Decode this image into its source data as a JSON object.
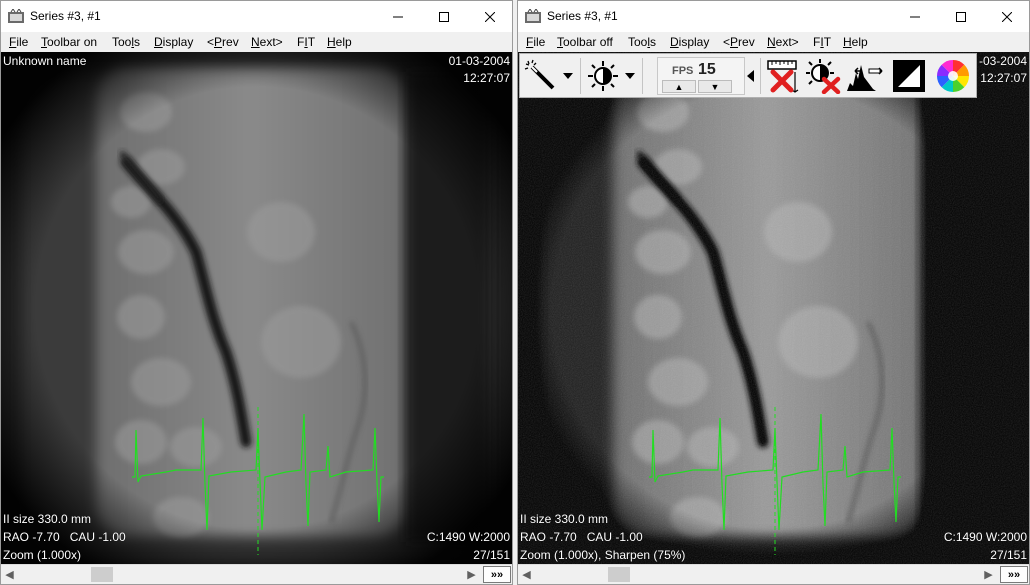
{
  "left_window": {
    "title": "Series #3, #1",
    "menu": {
      "file": {
        "pre": "",
        "acc": "F",
        "post": "ile"
      },
      "toolbar": {
        "pre": "",
        "acc": "T",
        "post": "oolbar on"
      },
      "tools": {
        "pre": "Too",
        "acc": "l",
        "post": "s"
      },
      "display": {
        "pre": "",
        "acc": "D",
        "post": "isplay"
      },
      "prev": {
        "pre": "<",
        "acc": "P",
        "post": "rev"
      },
      "next": {
        "pre": "",
        "acc": "N",
        "post": "ext>"
      },
      "fit": {
        "pre": "F",
        "acc": "I",
        "post": "T"
      },
      "help": {
        "pre": "",
        "acc": "H",
        "post": "elp"
      }
    },
    "overlay": {
      "patient_name": "Unknown name",
      "date": "01-03-2004",
      "time": "12:27:07",
      "ii_size": "II size 330.0 mm",
      "angles": "RAO -7.70   CAU -1.00",
      "zoom": "Zoom (1.000x)",
      "window": "C:1490 W:2000",
      "frame": "27/151"
    },
    "ff_label": "»»"
  },
  "right_window": {
    "title": "Series #3, #1",
    "menu": {
      "file": {
        "pre": "",
        "acc": "F",
        "post": "ile"
      },
      "toolbar": {
        "pre": "",
        "acc": "T",
        "post": "oolbar off"
      },
      "tools": {
        "pre": "Too",
        "acc": "l",
        "post": "s"
      },
      "display": {
        "pre": "",
        "acc": "D",
        "post": "isplay"
      },
      "prev": {
        "pre": "<",
        "acc": "P",
        "post": "rev"
      },
      "next": {
        "pre": "",
        "acc": "N",
        "post": "ext>"
      },
      "fit": {
        "pre": "F",
        "acc": "I",
        "post": "T"
      },
      "help": {
        "pre": "",
        "acc": "H",
        "post": "elp"
      }
    },
    "toolbar": {
      "fps_label": "FPS",
      "fps_value": "15",
      "icons": [
        "magic-wand-icon",
        "brightness-contrast-icon",
        "play-back-icon",
        "ruler-clear-icon",
        "brightness-reset-icon",
        "histogram-icon",
        "invert-icon",
        "color-wheel-icon"
      ]
    },
    "overlay": {
      "date": "-03-2004",
      "time": "12:27:07",
      "ii_size": "II size 330.0 mm",
      "angles": "RAO -7.70   CAU -1.00",
      "zoom": "Zoom (1.000x), Sharpen (75%)",
      "window": "C:1490 W:2000",
      "frame": "27/151"
    },
    "ff_label": "»»"
  },
  "colors": {
    "ecg_trace": "#22dd22",
    "overlay_text": "#ffffff",
    "close_x": "#e02020"
  }
}
